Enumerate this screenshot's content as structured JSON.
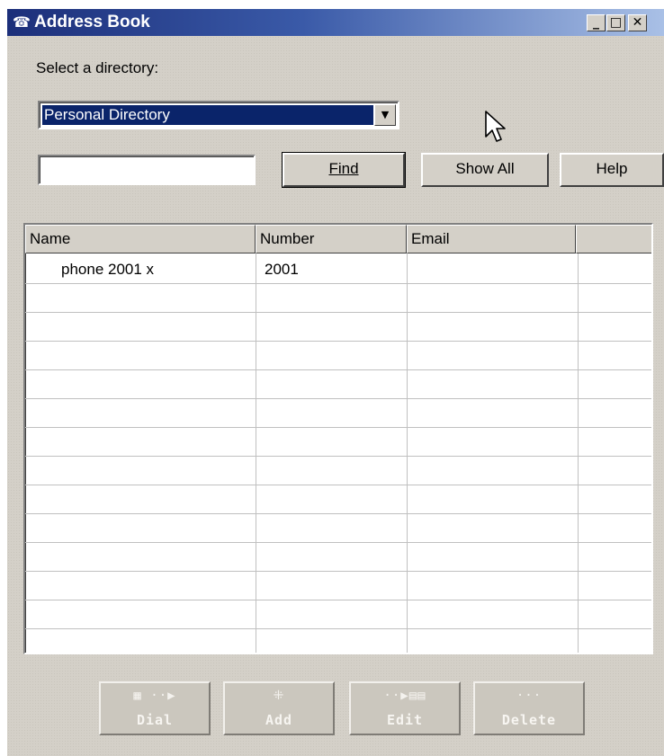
{
  "window": {
    "title": "Address Book",
    "title_icon": "phone-icon",
    "controls": {
      "minimize": "_",
      "maximize": "□",
      "close": "✕"
    }
  },
  "directory": {
    "label": "Select a directory:",
    "selected": "Personal Directory"
  },
  "search": {
    "value": "",
    "find_label": "Find",
    "show_all_label": "Show All",
    "help_label": "Help"
  },
  "table": {
    "columns": [
      "Name",
      "Number",
      "Email",
      ""
    ],
    "rows": [
      {
        "name": "phone 2001  x",
        "number": "2001",
        "email": ""
      }
    ]
  },
  "actions": {
    "dial": "Dial",
    "add": "Add",
    "edit": "Edit",
    "delete": "Delete"
  }
}
